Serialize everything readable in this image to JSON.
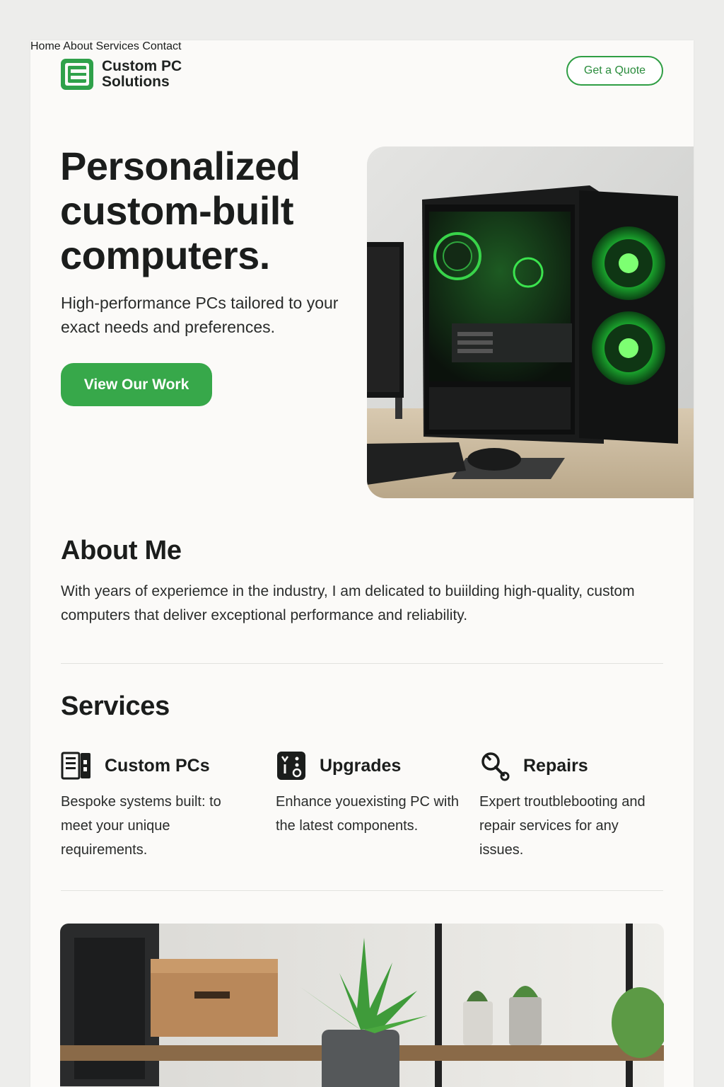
{
  "brand": {
    "name_line1": "Custom PC",
    "name_line2": "Solutions",
    "logo_icon": "logo-mark-icon"
  },
  "nav": {
    "items": [
      {
        "label": "Home"
      },
      {
        "label": "About"
      },
      {
        "label": "Services"
      },
      {
        "label": "Contact"
      }
    ],
    "cta_label": "Get a Quote"
  },
  "hero": {
    "title": "Personalized custom-built computers.",
    "subtitle": "High-performance PCs tailored to your exact needs and preferences.",
    "cta_label": "View Our Work",
    "image_icon": "gaming-pc-photo"
  },
  "about": {
    "heading": "About Me",
    "text": "With years of experiemce in the industry, I am delicated to buiilding high-quality, custom computers that deliver exceptional performance and reliability."
  },
  "services": {
    "heading": "Services",
    "items": [
      {
        "title": "Custom PCs",
        "description": "Bespoke systems built: to meet your unique requirements.",
        "icon": "pc-tower-icon"
      },
      {
        "title": "Upgrades",
        "description": "Enhance youexisting PC with the latest components.",
        "icon": "components-icon"
      },
      {
        "title": "Repairs",
        "description": "Expert troutblebooting and repair services for any issues.",
        "icon": "repair-wrench-icon"
      }
    ]
  },
  "colors": {
    "accent": "#37a84a",
    "accent_dark": "#2a8c3c",
    "text": "#1b1d1c",
    "page_bg": "#fbfaf8",
    "backdrop": "#ededeb"
  }
}
